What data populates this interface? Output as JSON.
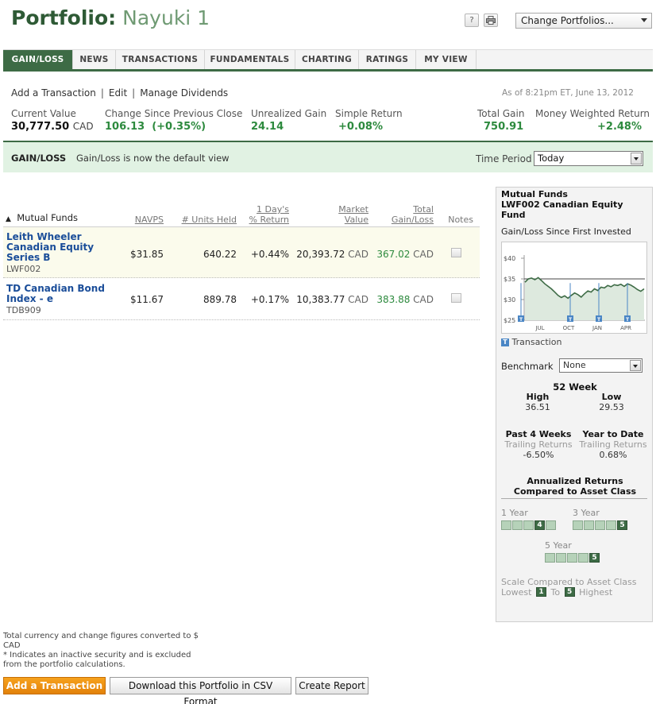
{
  "header": {
    "title": "Portfolio:",
    "portfolio_name": "Nayuki 1",
    "help_label": "?",
    "print_icon": "print-icon",
    "change_portfolios": "Change Portfolios..."
  },
  "tabs": [
    "GAIN/LOSS",
    "NEWS",
    "TRANSACTIONS",
    "FUNDAMENTALS",
    "CHARTING",
    "RATINGS",
    "MY VIEW"
  ],
  "actions": {
    "add_transaction": "Add a Transaction",
    "edit": "Edit",
    "manage_dividends": "Manage Dividends",
    "as_of": "As of 8:21pm ET, June 13, 2012"
  },
  "summary": {
    "current_value_label": "Current Value",
    "current_value": "30,777.50",
    "current_value_currency": "CAD",
    "change_label": "Change Since Previous Close",
    "change_value": "106.13  (+0.35%)",
    "unrealized_label": "Unrealized Gain",
    "unrealized_value": "24.14",
    "simple_return_label": "Simple Return",
    "simple_return_value": "+0.08%",
    "total_gain_label": "Total Gain",
    "total_gain_value": "750.91",
    "mwr_label": "Money Weighted Return",
    "mwr_value": "+2.48%"
  },
  "view_bar": {
    "title": "GAIN/LOSS",
    "description": "Gain/Loss is now the default view",
    "time_period_label": "Time Period",
    "time_period_value": "Today"
  },
  "table": {
    "headers": {
      "name": "Mutual Funds",
      "navps": "NAVPS",
      "units": "# Units Held",
      "day_return_1": "1 Day's",
      "day_return_2": "% Return",
      "market_1": "Market",
      "market_2": "Value",
      "gain_1": "Total",
      "gain_2": "Gain/Loss",
      "notes": "Notes"
    },
    "rows": [
      {
        "name_1": "Leith Wheeler",
        "name_2": "Canadian Equity",
        "name_3": "Series B",
        "ticker": "LWF002",
        "navps": "$31.85",
        "units": "640.22",
        "day_return": "+0.44%",
        "market_value": "20,393.72",
        "market_currency": "CAD",
        "gain": "367.02",
        "gain_currency": "CAD"
      },
      {
        "name_1": "TD Canadian Bond",
        "name_2": "Index - e",
        "name_3": "",
        "ticker": "TDB909",
        "navps": "$11.67",
        "units": "889.78",
        "day_return": "+0.17%",
        "market_value": "10,383.77",
        "market_currency": "CAD",
        "gain": "383.88",
        "gain_currency": "CAD"
      }
    ]
  },
  "panel": {
    "title_1": "Mutual Funds",
    "title_2": "LWF002 Canadian Equity",
    "title_3": "Fund",
    "subtitle": "Gain/Loss Since First Invested",
    "transaction_label": "Transaction",
    "transaction_marker": "T",
    "benchmark_label": "Benchmark",
    "benchmark_value": "None",
    "week52_title": "52 Week",
    "high_label": "High",
    "high_value": "36.51",
    "low_label": "Low",
    "low_value": "29.53",
    "past4_title": "Past 4 Weeks",
    "past4_sub": "Trailing Returns",
    "past4_value": "-6.50%",
    "ytd_title": "Year to Date",
    "ytd_sub": "Trailing Returns",
    "ytd_value": "0.68%",
    "annualized_1": "Annualized Returns",
    "annualized_2": "Compared to Asset Class",
    "rank_1y_label": "1 Year",
    "rank_1y": 4,
    "rank_3y_label": "3 Year",
    "rank_3y": 5,
    "rank_5y_label": "5 Year",
    "rank_5y": 5,
    "scale_1": "Scale Compared to Asset Class",
    "scale_lowest": "Lowest",
    "scale_low_num": "1",
    "scale_to": "To",
    "scale_high_num": "5",
    "scale_highest": "Highest"
  },
  "chart_data": {
    "type": "line",
    "title": "",
    "ylim": [
      25,
      40
    ],
    "yticks": [
      "$40",
      "$35",
      "$30",
      "$25"
    ],
    "xticks": [
      "JUL",
      "OCT",
      "JAN",
      "APR"
    ],
    "reference_line": 35,
    "series": [
      {
        "values": [
          34.2,
          35.0,
          35.2,
          34.8,
          35.3,
          34.6,
          33.8,
          33.2,
          32.6,
          31.8,
          31.0,
          30.5,
          30.9,
          30.3,
          31.0,
          31.6,
          31.2,
          30.6,
          31.4,
          32.1,
          31.8,
          32.6,
          32.2,
          33.0,
          32.8,
          33.4,
          33.1,
          33.6,
          33.4,
          33.7,
          33.2,
          33.8,
          33.5,
          33.0,
          32.4,
          32.0,
          32.6
        ]
      }
    ],
    "transaction_markers": [
      "T",
      "T",
      "T",
      "T",
      "T"
    ]
  },
  "footer": {
    "note_1": "Total currency and change figures converted to $",
    "note_2": "CAD",
    "note_3": "* Indicates an inactive security and is excluded",
    "note_4": "from the portfolio calculations.",
    "btn_add": "Add a Transaction",
    "btn_csv": "Download this Portfolio in CSV Format",
    "btn_report": "Create Report"
  }
}
